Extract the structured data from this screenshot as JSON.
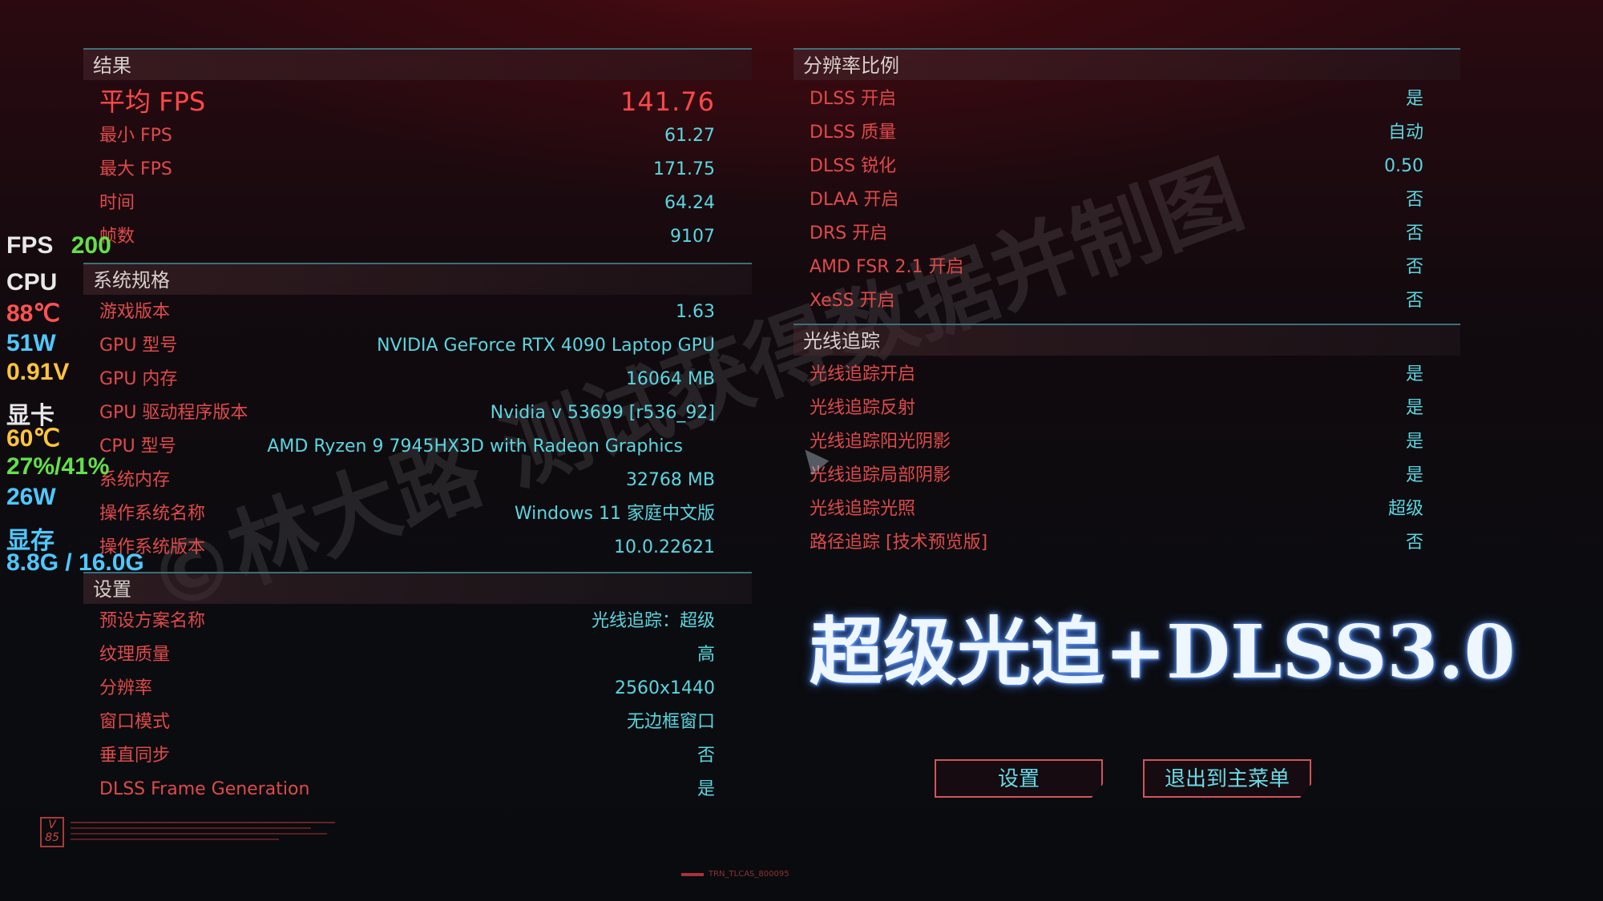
{
  "results": {
    "header": "结果",
    "avg_fps": {
      "label": "平均 FPS",
      "value": "141.76"
    },
    "rows": [
      {
        "label": "最小 FPS",
        "value": "61.27"
      },
      {
        "label": "最大 FPS",
        "value": "171.75"
      },
      {
        "label": "时间",
        "value": "64.24"
      },
      {
        "label": "帧数",
        "value": "9107"
      }
    ]
  },
  "system": {
    "header": "系统规格",
    "rows": [
      {
        "label": "游戏版本",
        "value": "1.63"
      },
      {
        "label": "GPU 型号",
        "value": "NVIDIA GeForce RTX 4090 Laptop GPU"
      },
      {
        "label": "GPU 内存",
        "value": "16064 MB"
      },
      {
        "label": "GPU 驱动程序版本",
        "value": "Nvidia v 53699 [r536_92]"
      },
      {
        "label": "CPU 型号",
        "value": "AMD Ryzen 9 7945HX3D with Radeon Graphics"
      },
      {
        "label": "系统内存",
        "value": "32768 MB"
      },
      {
        "label": "操作系统名称",
        "value": "Windows 11 家庭中文版"
      },
      {
        "label": "操作系统版本",
        "value": "10.0.22621"
      }
    ]
  },
  "settings": {
    "header": "设置",
    "rows": [
      {
        "label": "预设方案名称",
        "value": "光线追踪：超级"
      },
      {
        "label": "纹理质量",
        "value": "高"
      },
      {
        "label": "分辨率",
        "value": "2560x1440"
      },
      {
        "label": "窗口模式",
        "value": "无边框窗口"
      },
      {
        "label": "垂直同步",
        "value": "否"
      },
      {
        "label": "DLSS Frame Generation",
        "value": "是"
      }
    ]
  },
  "resolution_scaling": {
    "header": "分辨率比例",
    "rows": [
      {
        "label": "DLSS 开启",
        "value": "是"
      },
      {
        "label": "DLSS 质量",
        "value": "自动"
      },
      {
        "label": "DLSS 锐化",
        "value": "0.50"
      },
      {
        "label": "DLAA 开启",
        "value": "否"
      },
      {
        "label": "DRS 开启",
        "value": "否"
      },
      {
        "label": "AMD FSR 2.1 开启",
        "value": "否"
      },
      {
        "label": "XeSS 开启",
        "value": "否"
      }
    ]
  },
  "ray_tracing": {
    "header": "光线追踪",
    "rows": [
      {
        "label": "光线追踪开启",
        "value": "是"
      },
      {
        "label": "光线追踪反射",
        "value": "是"
      },
      {
        "label": "光线追踪阳光阴影",
        "value": "是"
      },
      {
        "label": "光线追踪局部阴影",
        "value": "是"
      },
      {
        "label": "光线追踪光照",
        "value": "超级"
      },
      {
        "label": "路径追踪 [技术预览版]",
        "value": "否"
      }
    ]
  },
  "osd": {
    "fps_label": "FPS",
    "fps_value": "200",
    "cpu_label": "CPU",
    "cpu_temp": "88℃",
    "cpu_power": "51W",
    "cpu_voltage": "0.91V",
    "gpu_label": "显卡",
    "gpu_temp": "60℃",
    "gpu_usage": "27%/41%",
    "gpu_power": "26W",
    "vram_label": "显存",
    "vram_value": "8.8G / 16.0G"
  },
  "watermark": "©林大路 测试获得数据并制图",
  "banner": "超级光追+DLSS3.0",
  "buttons": {
    "settings": "设置",
    "exit": "退出到主菜单"
  },
  "logo": "V 85",
  "footer_code": "TRN_TLCAS_800095",
  "colors": {
    "label_red": "#e04a4a",
    "value_cyan": "#5ad6e0",
    "accent_line": "#3e6f7a"
  }
}
